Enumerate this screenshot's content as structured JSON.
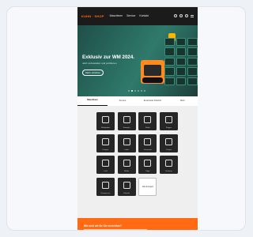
{
  "header": {
    "logo": "KUHN · SHOP",
    "nav": [
      "Maschinen",
      "Service",
      "Kontakt"
    ],
    "icons": [
      "search-icon",
      "user-icon",
      "cart-icon",
      "menu-icon"
    ]
  },
  "hero": {
    "title": "Exklusiv zur WM 2024.",
    "subtitle": "Jetzt vorbestellen und profitieren.",
    "button": "Mehr erfahren",
    "slides": 6,
    "active_slide": 1
  },
  "tabs": [
    {
      "label": "Maschinen",
      "active": true
    },
    {
      "label": "Service",
      "active": false
    },
    {
      "label": "Ersatzteile Zubehör",
      "active": false
    },
    {
      "label": "Mehr",
      "active": false
    }
  ],
  "categories": [
    {
      "label": "Rüttelplatte",
      "icon": "compactor-icon"
    },
    {
      "label": "Stampfer",
      "icon": "rammer-icon"
    },
    {
      "label": "Walze",
      "icon": "roller-icon"
    },
    {
      "label": "Bagger",
      "icon": "excavator-icon"
    },
    {
      "label": "Dumper",
      "icon": "dumper-icon"
    },
    {
      "label": "Lader",
      "icon": "loader-icon"
    },
    {
      "label": "Generator",
      "icon": "generator-icon"
    },
    {
      "label": "Pumpe",
      "icon": "pump-icon"
    },
    {
      "label": "Licht",
      "icon": "light-icon"
    },
    {
      "label": "Rüttler",
      "icon": "vibrator-icon"
    },
    {
      "label": "Säge",
      "icon": "saw-icon"
    },
    {
      "label": "Heizung",
      "icon": "heater-icon"
    },
    {
      "label": "Kompressor",
      "icon": "compressor-icon"
    },
    {
      "label": "Zubehör",
      "icon": "tool-icon"
    }
  ],
  "more_tile": "Alle anzeigen",
  "footer": {
    "title": "Wie sind wir für Sie erreichbar?"
  },
  "colors": {
    "accent": "#ff6a13",
    "hero": "#2f7a6c",
    "tile": "#262626"
  }
}
